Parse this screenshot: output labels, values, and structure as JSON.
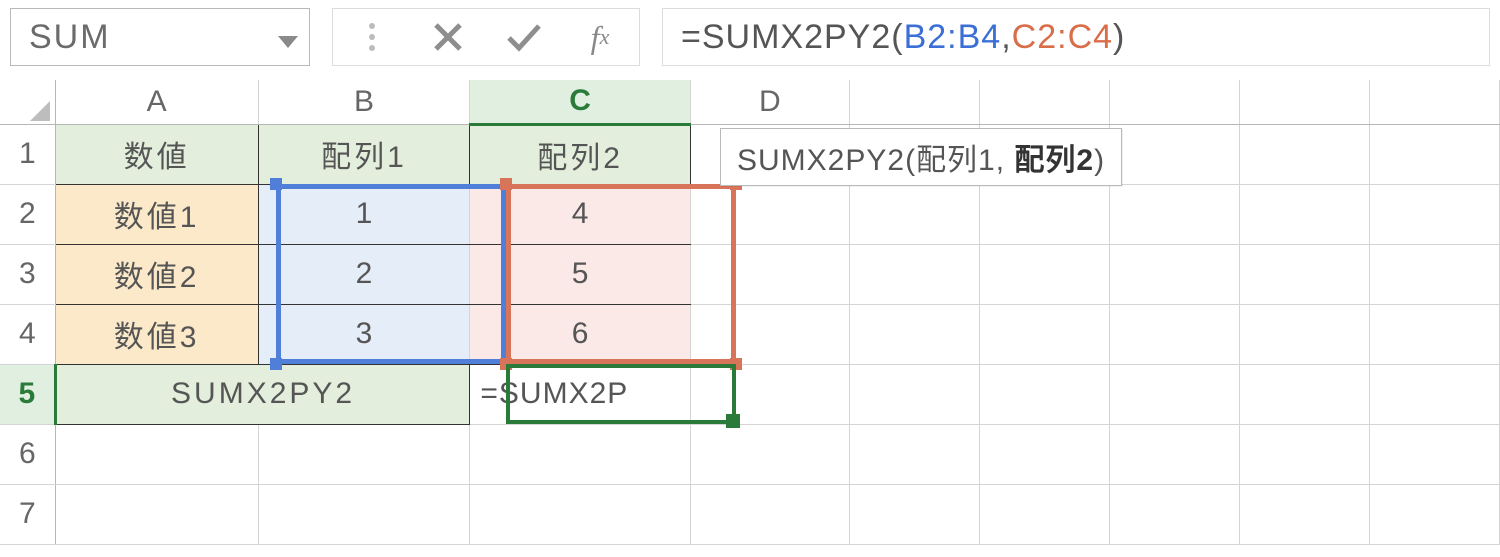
{
  "namebox": {
    "value": "SUM"
  },
  "formula": {
    "prefix": "=SUMX2PY2(",
    "ref1": "B2:B4",
    "sep": ",",
    "ref2": "C2:C4",
    "suffix": ")"
  },
  "columns": [
    "A",
    "B",
    "C",
    "D"
  ],
  "active_col": "C",
  "rows": [
    "1",
    "2",
    "3",
    "4",
    "5",
    "6",
    "7"
  ],
  "active_row": "5",
  "cells": {
    "A1": "数値",
    "B1": "配列1",
    "C1": "配列2",
    "A2": "数値1",
    "B2": "1",
    "C2": "4",
    "A3": "数値2",
    "B3": "2",
    "C3": "5",
    "A4": "数値3",
    "B4": "3",
    "C4": "6",
    "A5B5": "SUMX2PY2",
    "C5": "=SUMX2P"
  },
  "tooltip": {
    "fn": "SUMX2PY2(",
    "arg1": "配列1",
    "sep": ", ",
    "arg2": "配列2",
    "close": ")"
  }
}
